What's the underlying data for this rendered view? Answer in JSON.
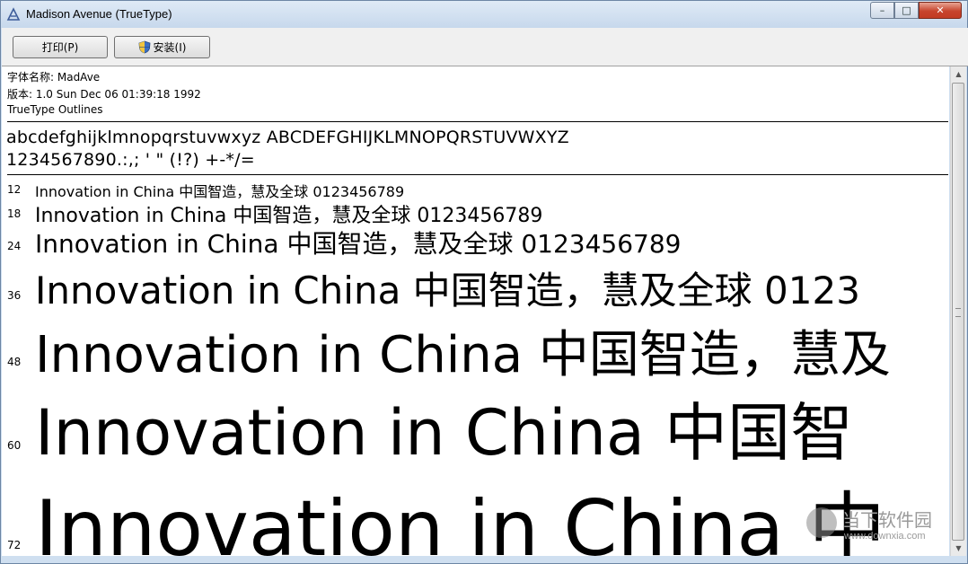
{
  "window": {
    "title": "Madison Avenue  (TrueType)",
    "controls": {
      "minimize": "–",
      "maximize": "□",
      "close": "✕"
    }
  },
  "toolbar": {
    "print_label": "打印(P)",
    "install_label": "安装(I)"
  },
  "font_info": {
    "name_line": "字体名称: MadAve",
    "version_line": "版本: 1.0 Sun Dec 06 01:39:18 1992",
    "outline_line": "TrueType Outlines"
  },
  "charset": {
    "line1": "abcdefghijklmnopqrstuvwxyz ABCDEFGHIJKLMNOPQRSTUVWXYZ",
    "line2": "1234567890.:,; ' \" (!?) +-*/="
  },
  "samples": [
    {
      "size": "12",
      "text": "Innovation in China 中国智造，慧及全球 0123456789"
    },
    {
      "size": "18",
      "text": "Innovation in China 中国智造，慧及全球 0123456789"
    },
    {
      "size": "24",
      "text": "Innovation in China 中国智造，慧及全球 0123456789"
    },
    {
      "size": "36",
      "text": "Innovation in China 中国智造，慧及全球 0123"
    },
    {
      "size": "48",
      "text": "Innovation in China 中国智造，慧及"
    },
    {
      "size": "60",
      "text": "Innovation in China 中国智"
    },
    {
      "size": "72",
      "text": "Innovation in China 中"
    }
  ],
  "watermark": {
    "text": "当下软件园",
    "url": "www.downxia.com"
  },
  "colors": {
    "close_button": "#c7442d",
    "title_bar": "#cfdff0"
  }
}
